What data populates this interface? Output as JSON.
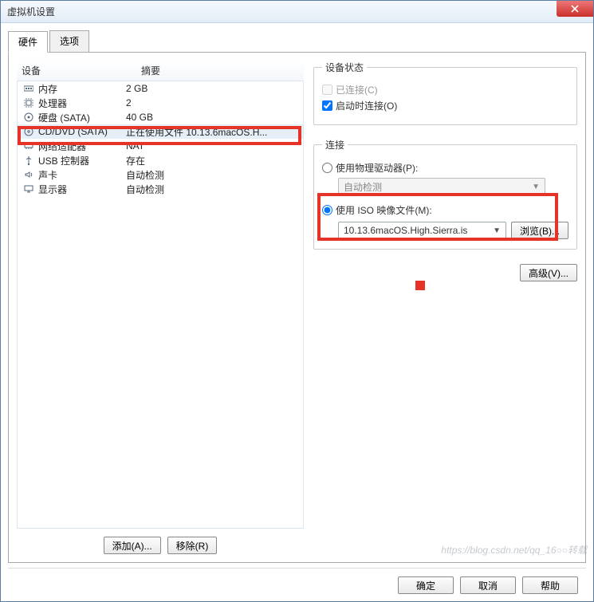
{
  "window": {
    "title": "虚拟机设置"
  },
  "tabs": {
    "hardware": "硬件",
    "options": "选项"
  },
  "columns": {
    "device": "设备",
    "summary": "摘要"
  },
  "hw": [
    {
      "icon": "memory-icon",
      "name": "内存",
      "summary": "2 GB"
    },
    {
      "icon": "cpu-icon",
      "name": "处理器",
      "summary": "2"
    },
    {
      "icon": "disk-icon",
      "name": "硬盘 (SATA)",
      "summary": "40 GB"
    },
    {
      "icon": "cd-icon",
      "name": "CD/DVD (SATA)",
      "summary": "正在使用文件 10.13.6macOS.H..."
    },
    {
      "icon": "net-icon",
      "name": "网络适配器",
      "summary": "NAT"
    },
    {
      "icon": "usb-icon",
      "name": "USB 控制器",
      "summary": "存在"
    },
    {
      "icon": "sound-icon",
      "name": "声卡",
      "summary": "自动检测"
    },
    {
      "icon": "display-icon",
      "name": "显示器",
      "summary": "自动检测"
    }
  ],
  "left_buttons": {
    "add": "添加(A)...",
    "remove": "移除(R)"
  },
  "status": {
    "legend": "设备状态",
    "connected": "已连接(C)",
    "connect_on_start": "启动时连接(O)"
  },
  "connection": {
    "legend": "连接",
    "use_physical": "使用物理驱动器(P):",
    "auto_detect": "自动检测",
    "use_iso": "使用 ISO 映像文件(M):",
    "iso_path": "10.13.6macOS.High.Sierra.is",
    "browse": "浏览(B)..."
  },
  "advanced": "高级(V)...",
  "footer": {
    "ok": "确定",
    "cancel": "取消",
    "help": "帮助"
  },
  "watermark": "https://blog.csdn.net/qq_16○○转载"
}
